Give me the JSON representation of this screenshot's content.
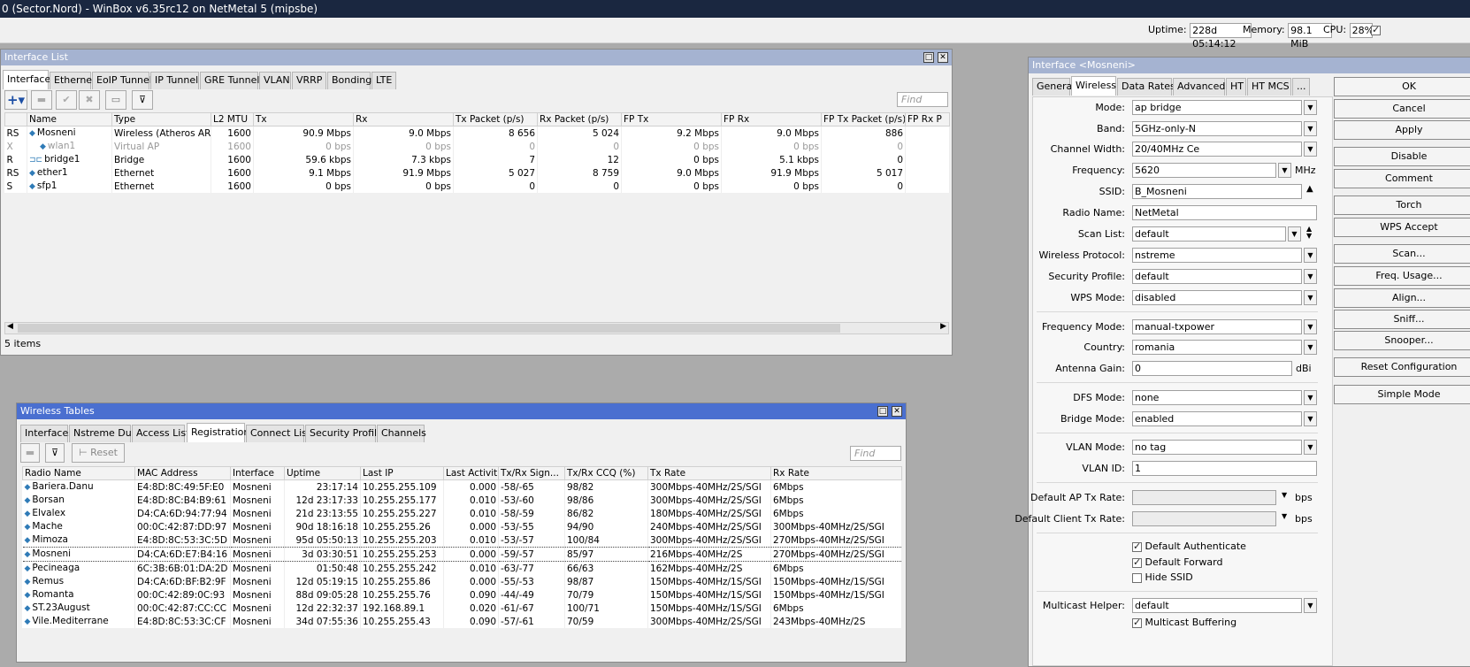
{
  "app_title": "0 (Sector.Nord) - WinBox v6.35rc12 on NetMetal 5 (mipsbe)",
  "stats": {
    "uptime_label": "Uptime:",
    "uptime": "228d 05:14:12",
    "memory_label": "Memory:",
    "memory": "98.1 MiB",
    "cpu_label": "CPU:",
    "cpu": "28%"
  },
  "interface_list": {
    "title": "Interface List",
    "tabs": [
      "Interface",
      "Ethernet",
      "EoIP Tunnel",
      "IP Tunnel",
      "GRE Tunnel",
      "VLAN",
      "VRRP",
      "Bonding",
      "LTE"
    ],
    "find_placeholder": "Find",
    "columns": [
      "",
      "Name",
      "Type",
      "L2 MTU",
      "Tx",
      "Rx",
      "Tx Packet (p/s)",
      "Rx Packet (p/s)",
      "FP Tx",
      "FP Rx",
      "FP Tx Packet (p/s)",
      "FP Rx P"
    ],
    "rows": [
      {
        "flag": "RS",
        "name": "Mosneni",
        "type": "Wireless (Atheros AR9...",
        "mtu": "1600",
        "tx": "90.9 Mbps",
        "rx": "9.0 Mbps",
        "txp": "8 656",
        "rxp": "5 024",
        "fptx": "9.2 Mbps",
        "fprx": "9.0 Mbps",
        "fptxp": "886",
        "disabled": false
      },
      {
        "flag": "X",
        "name": "wlan1",
        "type": "Virtual AP",
        "mtu": "1600",
        "tx": "0 bps",
        "rx": "0 bps",
        "txp": "0",
        "rxp": "0",
        "fptx": "0 bps",
        "fprx": "0 bps",
        "fptxp": "0",
        "disabled": true
      },
      {
        "flag": "R",
        "name": "bridge1",
        "type": "Bridge",
        "mtu": "1600",
        "tx": "59.6 kbps",
        "rx": "7.3 kbps",
        "txp": "7",
        "rxp": "12",
        "fptx": "0 bps",
        "fprx": "5.1 kbps",
        "fptxp": "0",
        "disabled": false
      },
      {
        "flag": "RS",
        "name": "ether1",
        "type": "Ethernet",
        "mtu": "1600",
        "tx": "9.1 Mbps",
        "rx": "91.9 Mbps",
        "txp": "5 027",
        "rxp": "8 759",
        "fptx": "9.0 Mbps",
        "fprx": "91.9 Mbps",
        "fptxp": "5 017",
        "disabled": false
      },
      {
        "flag": "S",
        "name": "sfp1",
        "type": "Ethernet",
        "mtu": "1600",
        "tx": "0 bps",
        "rx": "0 bps",
        "txp": "0",
        "rxp": "0",
        "fptx": "0 bps",
        "fprx": "0 bps",
        "fptxp": "0",
        "disabled": false
      }
    ],
    "status": "5 items"
  },
  "wireless_tables": {
    "title": "Wireless Tables",
    "tabs": [
      "Interfaces",
      "Nstreme Dual",
      "Access List",
      "Registration",
      "Connect List",
      "Security Profiles",
      "Channels"
    ],
    "reset_label": "Reset",
    "find_placeholder": "Find",
    "columns": [
      "Radio Name",
      "MAC Address",
      "Interface",
      "Uptime",
      "Last IP",
      "Last Activit...",
      "Tx/Rx Sign...",
      "Tx/Rx CCQ (%)",
      "Tx Rate",
      "Rx Rate"
    ],
    "rows": [
      [
        "Bariera.Danu",
        "E4:8D:8C:49:5F:E0",
        "Mosneni",
        "23:17:14",
        "10.255.255.109",
        "0.000",
        "-58/-65",
        "98/82",
        "300Mbps-40MHz/2S/SGI",
        "6Mbps"
      ],
      [
        "Borsan",
        "E4:8D:8C:B4:B9:61",
        "Mosneni",
        "12d 23:17:33",
        "10.255.255.177",
        "0.010",
        "-53/-60",
        "98/86",
        "300Mbps-40MHz/2S/SGI",
        "6Mbps"
      ],
      [
        "Elvalex",
        "D4:CA:6D:94:77:94",
        "Mosneni",
        "21d 23:13:55",
        "10.255.255.227",
        "0.010",
        "-58/-59",
        "86/82",
        "180Mbps-40MHz/2S/SGI",
        "6Mbps"
      ],
      [
        "Mache",
        "00:0C:42:87:DD:97",
        "Mosneni",
        "90d 18:16:18",
        "10.255.255.26",
        "0.000",
        "-53/-55",
        "94/90",
        "240Mbps-40MHz/2S/SGI",
        "300Mbps-40MHz/2S/SGI"
      ],
      [
        "Mimoza",
        "E4:8D:8C:53:3C:5D",
        "Mosneni",
        "95d 05:50:13",
        "10.255.255.203",
        "0.010",
        "-53/-57",
        "100/84",
        "300Mbps-40MHz/2S/SGI",
        "270Mbps-40MHz/2S/SGI"
      ],
      [
        "Mosneni",
        "D4:CA:6D:E7:B4:16",
        "Mosneni",
        "3d 03:30:51",
        "10.255.255.253",
        "0.000",
        "-59/-57",
        "85/97",
        "216Mbps-40MHz/2S",
        "270Mbps-40MHz/2S/SGI"
      ],
      [
        "Pecineaga",
        "6C:3B:6B:01:DA:2D",
        "Mosneni",
        "01:50:48",
        "10.255.255.242",
        "0.010",
        "-63/-77",
        "66/63",
        "162Mbps-40MHz/2S",
        "6Mbps"
      ],
      [
        "Remus",
        "D4:CA:6D:BF:B2:9F",
        "Mosneni",
        "12d 05:19:15",
        "10.255.255.86",
        "0.000",
        "-55/-53",
        "98/87",
        "150Mbps-40MHz/1S/SGI",
        "150Mbps-40MHz/1S/SGI"
      ],
      [
        "Romanta",
        "00:0C:42:89:0C:93",
        "Mosneni",
        "88d 09:05:28",
        "10.255.255.76",
        "0.090",
        "-44/-49",
        "70/79",
        "150Mbps-40MHz/1S/SGI",
        "150Mbps-40MHz/1S/SGI"
      ],
      [
        "ST.23August",
        "00:0C:42:87:CC:CC",
        "Mosneni",
        "12d 22:32:37",
        "192.168.89.1",
        "0.020",
        "-61/-67",
        "100/71",
        "150Mbps-40MHz/1S/SGI",
        "6Mbps"
      ],
      [
        "Vile.Mediterrane",
        "E4:8D:8C:53:3C:CF",
        "Mosneni",
        "34d 07:55:36",
        "10.255.255.43",
        "0.090",
        "-57/-61",
        "70/59",
        "300Mbps-40MHz/2S/SGI",
        "243Mbps-40MHz/2S"
      ]
    ]
  },
  "iface_window": {
    "title": "Interface <Mosneni>",
    "tabs": [
      "General",
      "Wireless",
      "Data Rates",
      "Advanced",
      "HT",
      "HT MCS",
      "..."
    ],
    "fields": {
      "mode_l": "Mode:",
      "mode": "ap bridge",
      "band_l": "Band:",
      "band": "5GHz-only-N",
      "chw_l": "Channel Width:",
      "chw": "20/40MHz Ce",
      "freq_l": "Frequency:",
      "freq": "5620",
      "freq_unit": "MHz",
      "ssid_l": "SSID:",
      "ssid": "B_Mosneni",
      "radio_l": "Radio Name:",
      "radio": "NetMetal",
      "scan_l": "Scan List:",
      "scan": "default",
      "wproto_l": "Wireless Protocol:",
      "wproto": "nstreme",
      "secp_l": "Security Profile:",
      "secp": "default",
      "wps_l": "WPS Mode:",
      "wps": "disabled",
      "fmode_l": "Frequency Mode:",
      "fmode": "manual-txpower",
      "country_l": "Country:",
      "country": "romania",
      "gain_l": "Antenna Gain:",
      "gain": "0",
      "gain_unit": "dBi",
      "dfs_l": "DFS Mode:",
      "dfs": "none",
      "bmode_l": "Bridge Mode:",
      "bmode": "enabled",
      "vmode_l": "VLAN Mode:",
      "vmode": "no tag",
      "vid_l": "VLAN ID:",
      "vid": "1",
      "aptx_l": "Default AP Tx Rate:",
      "aptx_unit": "bps",
      "cltx_l": "Default Client Tx Rate:",
      "cltx_unit": "bps",
      "cb1": "Default Authenticate",
      "cb2": "Default Forward",
      "cb3": "Hide SSID",
      "mh_l": "Multicast Helper:",
      "mh": "default",
      "mb": "Multicast Buffering"
    },
    "buttons": [
      "OK",
      "Cancel",
      "Apply",
      "Disable",
      "Comment",
      "Torch",
      "WPS Accept",
      "Scan...",
      "Freq. Usage...",
      "Align...",
      "Sniff...",
      "Snooper...",
      "Reset Configuration",
      "Simple Mode"
    ]
  }
}
